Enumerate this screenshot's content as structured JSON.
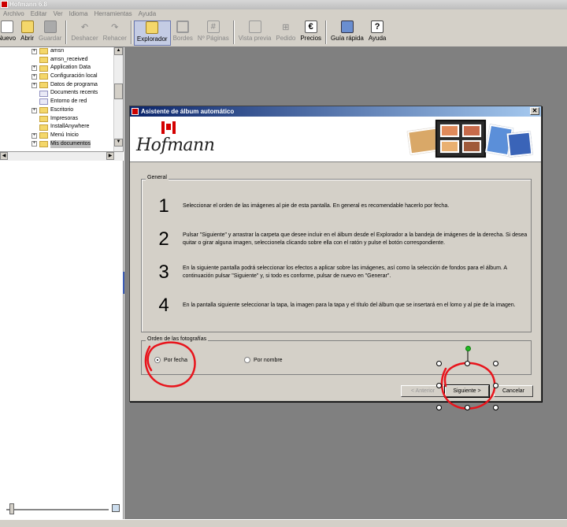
{
  "app": {
    "title": "Hofmann 6.8"
  },
  "menu": [
    "Archivo",
    "Editar",
    "Ver",
    "Idioma",
    "Herramientas",
    "Ayuda"
  ],
  "toolbar": [
    {
      "label": "Nuevo",
      "icon": "new-album-icon",
      "enabled": true
    },
    {
      "label": "Abrir",
      "icon": "open-folder-icon",
      "enabled": true
    },
    {
      "label": "Guardar",
      "icon": "save-disk-icon",
      "enabled": false
    },
    {
      "label": "Deshacer",
      "icon": "undo-icon",
      "enabled": false
    },
    {
      "label": "Rehacer",
      "icon": "redo-icon",
      "enabled": false
    },
    {
      "label": "Explorador",
      "icon": "explorer-icon",
      "enabled": true,
      "selected": true
    },
    {
      "label": "Bordes",
      "icon": "borders-icon",
      "enabled": false
    },
    {
      "label": "Nº Páginas",
      "icon": "page-count-icon",
      "enabled": false
    },
    {
      "label": "Vista previa",
      "icon": "preview-icon",
      "enabled": false
    },
    {
      "label": "Pedido",
      "icon": "cart-icon",
      "enabled": false
    },
    {
      "label": "Precios",
      "icon": "euro-icon",
      "enabled": true
    },
    {
      "label": "Guía rápida",
      "icon": "quick-guide-icon",
      "enabled": true
    },
    {
      "label": "Ayuda",
      "icon": "help-icon",
      "enabled": true
    }
  ],
  "tree": [
    {
      "label": "amsn",
      "expandable": true
    },
    {
      "label": "amsn_received",
      "expandable": false
    },
    {
      "label": "Application Data",
      "expandable": true
    },
    {
      "label": "Configuración local",
      "expandable": true
    },
    {
      "label": "Datos de programa",
      "expandable": true
    },
    {
      "label": "Documents recents",
      "expandable": false,
      "doc": true
    },
    {
      "label": "Entorno de red",
      "expandable": false,
      "doc": true
    },
    {
      "label": "Escritorio",
      "expandable": true
    },
    {
      "label": "Impresoras",
      "expandable": false
    },
    {
      "label": "InstallAnywhere",
      "expandable": false
    },
    {
      "label": "Menú Inicio",
      "expandable": true
    },
    {
      "label": "Mis documentos",
      "expandable": true,
      "selected": true
    }
  ],
  "dialog": {
    "title": "Asistente de álbum automático",
    "brand": "Hofmann",
    "general_label": "General",
    "steps": [
      {
        "num": "1",
        "text": "Seleccionar el orden de las imágenes al pie de esta pantalla. En general es recomendable hacerlo por fecha."
      },
      {
        "num": "2",
        "text": "Pulsar \"Siguiente\" y arrastrar la carpeta que desee incluir en el álbum desde el Explorador a la bandeja de imágenes de la derecha. Si desea quitar o girar alguna imagen, seleccionela clicando sobre ella con el ratón y pulse el botón correspondiente."
      },
      {
        "num": "3",
        "text": "En la siguiente pantalla podrá seleccionar los efectos a aplicar sobre las imágenes, así como la selección de fondos para el álbum. A continuación pulsar \"Siguiente\" y, si todo es conforme, pulsar de nuevo en \"Generar\"."
      },
      {
        "num": "4",
        "text": "En la pantalla siguiente seleccionar la tapa, la imagen para la tapa y el título del álbum que se insertará en el lomo y al pie de la imagen."
      }
    ],
    "order_label": "Orden de las fotografías",
    "radio_date": "Por fecha",
    "radio_name": "Por nombre",
    "selected_order": "Por fecha",
    "btn_prev": "< Anterior",
    "btn_next": "Siguiente >",
    "btn_cancel": "Cancelar"
  },
  "colors": {
    "annotation": "#e8141c",
    "desktop": "#808080",
    "dialog_title": "#0a246a"
  }
}
